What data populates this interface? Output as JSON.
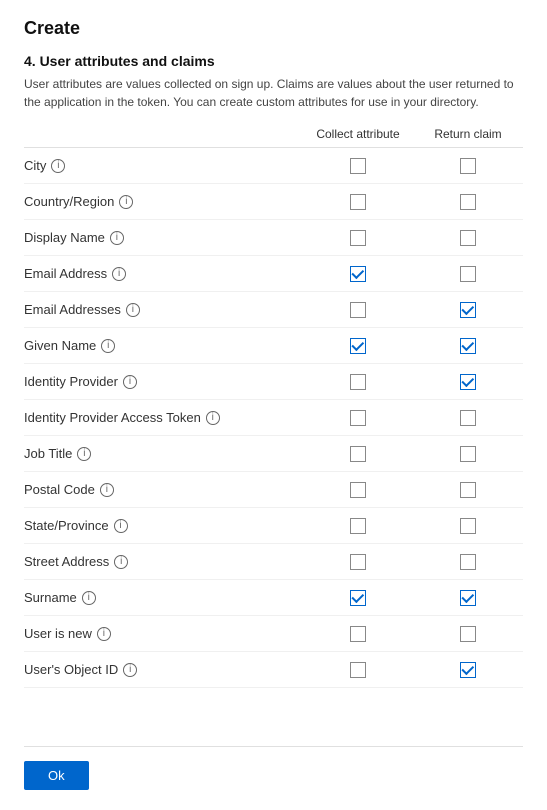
{
  "page": {
    "title": "Create",
    "section_number": "4. User attributes and claims",
    "section_desc": "User attributes are values collected on sign up. Claims are values about the user returned to the application in the token. You can create custom attributes for use in your directory.",
    "col_collect": "Collect attribute",
    "col_return": "Return claim",
    "ok_label": "Ok"
  },
  "attributes": [
    {
      "name": "City",
      "collect": false,
      "return": false
    },
    {
      "name": "Country/Region",
      "collect": false,
      "return": false
    },
    {
      "name": "Display Name",
      "collect": false,
      "return": false
    },
    {
      "name": "Email Address",
      "collect": true,
      "return": false
    },
    {
      "name": "Email Addresses",
      "collect": false,
      "return": true
    },
    {
      "name": "Given Name",
      "collect": true,
      "return": true
    },
    {
      "name": "Identity Provider",
      "collect": false,
      "return": true
    },
    {
      "name": "Identity Provider Access Token",
      "collect": false,
      "return": false
    },
    {
      "name": "Job Title",
      "collect": false,
      "return": false
    },
    {
      "name": "Postal Code",
      "collect": false,
      "return": false
    },
    {
      "name": "State/Province",
      "collect": false,
      "return": false
    },
    {
      "name": "Street Address",
      "collect": false,
      "return": false
    },
    {
      "name": "Surname",
      "collect": true,
      "return": true
    },
    {
      "name": "User is new",
      "collect": false,
      "return": false
    },
    {
      "name": "User's Object ID",
      "collect": false,
      "return": true
    }
  ]
}
